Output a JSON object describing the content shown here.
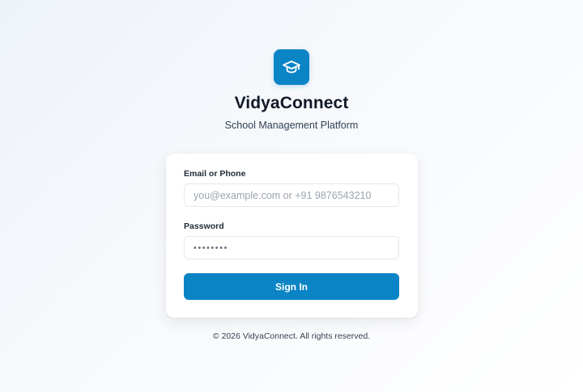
{
  "brand": {
    "logo_icon": "graduation-cap-icon",
    "title": "VidyaConnect",
    "subtitle": "School Management Platform",
    "accent_color": "#0b84c6"
  },
  "form": {
    "email_label": "Email or Phone",
    "email_value": "",
    "email_placeholder": "you@example.com or +91 9876543210",
    "password_label": "Password",
    "password_value": "••••••••",
    "submit_label": "Sign In"
  },
  "footer": {
    "text": "© 2026 VidyaConnect. All rights reserved."
  }
}
